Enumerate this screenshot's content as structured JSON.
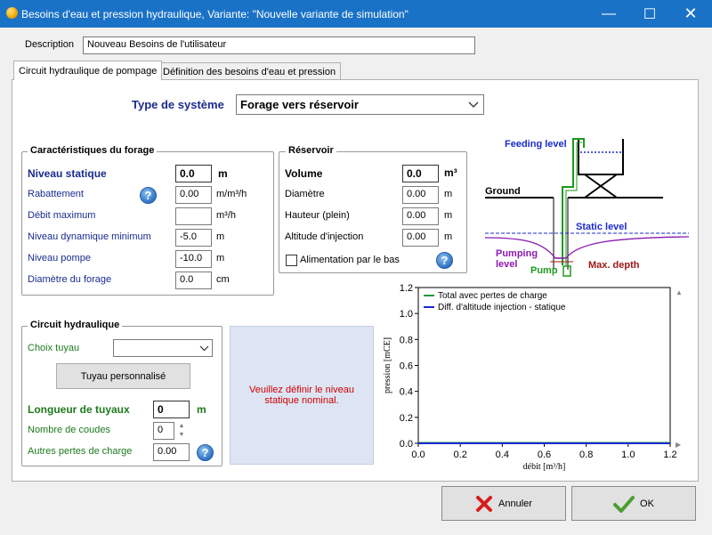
{
  "window": {
    "title": "Besoins d'eau et pression hydraulique, Variante:   \"Nouvelle variante de simulation\"",
    "minimize": "—",
    "maximize": "☐",
    "close": "✕"
  },
  "description": {
    "label": "Description",
    "value": "Nouveau Besoins de l'utilisateur"
  },
  "tabs": [
    {
      "label": "Circuit hydraulique de pompage"
    },
    {
      "label": "Définition des besoins d'eau et pression"
    }
  ],
  "system_type": {
    "label": "Type de système",
    "value": "Forage vers réservoir"
  },
  "forage": {
    "title": "Caractéristiques du forage",
    "rows": [
      {
        "label": "Niveau statique",
        "value": "0.0",
        "unit": "m"
      },
      {
        "label": "Rabattement",
        "value": "0.00",
        "unit": "m/m³/h"
      },
      {
        "label": "Débit maximum",
        "value": "",
        "unit": "m³/h"
      },
      {
        "label": "Niveau dynamique minimum",
        "value": "-5.0",
        "unit": "m"
      },
      {
        "label": "Niveau pompe",
        "value": "-10.0",
        "unit": "m"
      },
      {
        "label": "Diamètre du forage",
        "value": "0.0",
        "unit": "cm"
      }
    ]
  },
  "reservoir": {
    "title": "Réservoir",
    "rows": [
      {
        "label": "Volume",
        "value": "0.0",
        "unit": "m³"
      },
      {
        "label": "Diamètre",
        "value": "0.00",
        "unit": "m"
      },
      {
        "label": "Hauteur (plein)",
        "value": "0.00",
        "unit": "m"
      },
      {
        "label": "Altitude d'injection",
        "value": "0.00",
        "unit": "m"
      }
    ],
    "checkbox_label": "Alimentation par le bas",
    "checkbox_checked": false
  },
  "diagram": {
    "feeding_level": "Feeding level",
    "ground": "Ground",
    "static_level": "Static level",
    "pumping_level": "Pumping\nlevel",
    "pump": "Pump",
    "max_depth": "Max. depth"
  },
  "circuit": {
    "title": "Circuit hydraulique",
    "pipe_choice_label": "Choix tuyau",
    "pipe_choice_value": "",
    "custom_pipe_button": "Tuyau personnalisé",
    "length_label": "Longueur de tuyaux",
    "length_value": "0",
    "length_unit": "m",
    "elbows_label": "Nombre de coudes",
    "elbows_value": "0",
    "other_losses_label": "Autres pertes de charge",
    "other_losses_value": "0.00"
  },
  "warning": "Veuillez définir le niveau statique nominal.",
  "chart_data": {
    "type": "line",
    "xlabel": "débit [m³/h]",
    "ylabel": "pression [mCE]",
    "xlim": [
      0,
      1.2
    ],
    "ylim": [
      0,
      1.2
    ],
    "xticks": [
      "0.0",
      "0.2",
      "0.4",
      "0.6",
      "0.8",
      "1.0",
      "1.2"
    ],
    "yticks": [
      "0.0",
      "0.2",
      "0.4",
      "0.6",
      "0.8",
      "1.0",
      "1.2"
    ],
    "legend_position": "top-left",
    "series": [
      {
        "name": "Total avec pertes de charge",
        "color": "#1f9a3a",
        "x": [
          0,
          1.2
        ],
        "y": [
          0,
          0
        ]
      },
      {
        "name": "Diff. d'altitude injection - statique",
        "color": "#1a2bd0",
        "x": [
          0,
          1.2
        ],
        "y": [
          0,
          0
        ]
      }
    ]
  },
  "buttons": {
    "cancel": "Annuler",
    "ok": "OK"
  },
  "colors": {
    "titlebar": "#1a72c7",
    "accent_blue": "#1a2b8f",
    "label_green": "#1d7a1d",
    "warning_red": "#d00000"
  }
}
